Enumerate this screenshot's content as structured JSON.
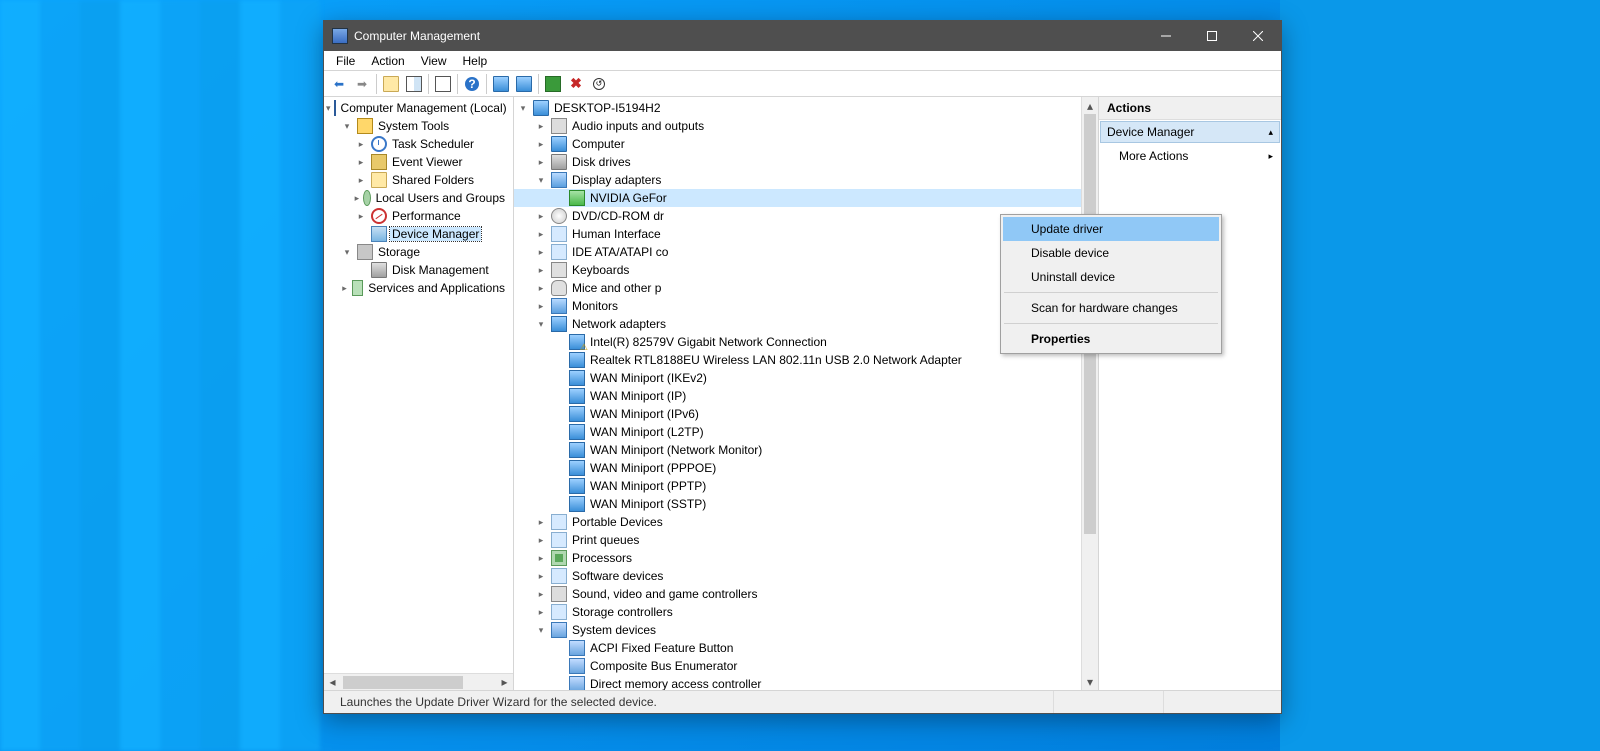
{
  "titlebar": {
    "title": "Computer Management"
  },
  "menubar": [
    "File",
    "Action",
    "View",
    "Help"
  ],
  "toolbar_icons": [
    "back",
    "forward",
    "|",
    "up",
    "show-hide",
    "|",
    "export",
    "|",
    "help",
    "|",
    "view-large",
    "view-small",
    "|",
    "scan-hardware",
    "delete",
    "enable"
  ],
  "left_tree": {
    "root": "Computer Management (Local)",
    "system_tools": {
      "label": "System Tools",
      "children": {
        "task_scheduler": "Task Scheduler",
        "event_viewer": "Event Viewer",
        "shared_folders": "Shared Folders",
        "local_users": "Local Users and Groups",
        "performance": "Performance",
        "device_manager": "Device Manager"
      }
    },
    "storage": {
      "label": "Storage",
      "children": {
        "disk_management": "Disk Management"
      }
    },
    "services": {
      "label": "Services and Applications"
    }
  },
  "device_tree": {
    "root": "DESKTOP-I5194H2",
    "audio": "Audio inputs and outputs",
    "computer": "Computer",
    "disk_drives": "Disk drives",
    "display_adapters": {
      "label": "Display adapters",
      "children": {
        "nvidia": "NVIDIA GeFor"
      }
    },
    "dvd": "DVD/CD-ROM dr",
    "hid": "Human Interface",
    "ide": "IDE ATA/ATAPI co",
    "keyboards": "Keyboards",
    "mice": "Mice and other p",
    "monitors": "Monitors",
    "network": {
      "label": "Network adapters",
      "children": {
        "intel": "Intel(R) 82579V Gigabit Network Connection",
        "realtek": "Realtek RTL8188EU Wireless LAN 802.11n USB 2.0 Network Adapter",
        "wan_ikev2": "WAN Miniport (IKEv2)",
        "wan_ip": "WAN Miniport (IP)",
        "wan_ipv6": "WAN Miniport (IPv6)",
        "wan_l2tp": "WAN Miniport (L2TP)",
        "wan_nm": "WAN Miniport (Network Monitor)",
        "wan_pppoe": "WAN Miniport (PPPOE)",
        "wan_pptp": "WAN Miniport (PPTP)",
        "wan_sstp": "WAN Miniport (SSTP)"
      }
    },
    "portable": "Portable Devices",
    "printq": "Print queues",
    "processors": "Processors",
    "softdev": "Software devices",
    "sound": "Sound, video and game controllers",
    "storagectl": "Storage controllers",
    "sysdev": {
      "label": "System devices",
      "children": {
        "acpi": "ACPI Fixed Feature Button",
        "composite": "Composite Bus Enumerator",
        "dma": "Direct memory access controller"
      }
    }
  },
  "context_menu": {
    "update": "Update driver",
    "disable": "Disable device",
    "uninstall": "Uninstall device",
    "scan": "Scan for hardware changes",
    "properties": "Properties"
  },
  "actions_pane": {
    "header": "Actions",
    "section": "Device Manager",
    "more": "More Actions"
  },
  "statusbar": {
    "text": "Launches the Update Driver Wizard for the selected device."
  }
}
